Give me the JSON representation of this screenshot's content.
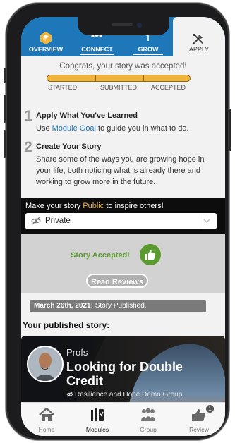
{
  "tabs": [
    {
      "label": "OVERVIEW"
    },
    {
      "label": "CONNECT"
    },
    {
      "label": "GROW"
    },
    {
      "label": "APPLY"
    }
  ],
  "progress": {
    "message": "Congrats, your story was accepted!",
    "steps": [
      "STARTED",
      "SUBMITTED",
      "ACCEPTED"
    ]
  },
  "step1": {
    "number": "1",
    "title": "Apply What You've Learned",
    "body_prefix": "Use ",
    "link": "Module Goal",
    "body_suffix": " to guide you in what to do."
  },
  "step2": {
    "number": "2",
    "title": "Create Your Story",
    "body": "Share some of the ways you are growing hope in your life, both noticing what is already there and working to grow more in the future."
  },
  "visibility": {
    "prompt_prefix": "Make your story ",
    "prompt_highlight": "Public",
    "prompt_suffix": " to inspire others!",
    "selected": "Private"
  },
  "accepted": {
    "label": "Story Accepted!",
    "read_button": "Read Reviews"
  },
  "history": {
    "date": "March 26th, 2021:",
    "event": " Story Published."
  },
  "published": {
    "heading": "Your published story:",
    "author": "Profs",
    "title": "Looking for Double Credit",
    "group": "Resilience and Hope Demo Group"
  },
  "nav": [
    {
      "label": "Home"
    },
    {
      "label": "Modules"
    },
    {
      "label": "Group"
    },
    {
      "label": "Review",
      "badge": "1"
    }
  ],
  "colors": {
    "brand_blue": "#1d77b9",
    "gold": "#f1b43a",
    "success_green": "#5a9a2e"
  }
}
